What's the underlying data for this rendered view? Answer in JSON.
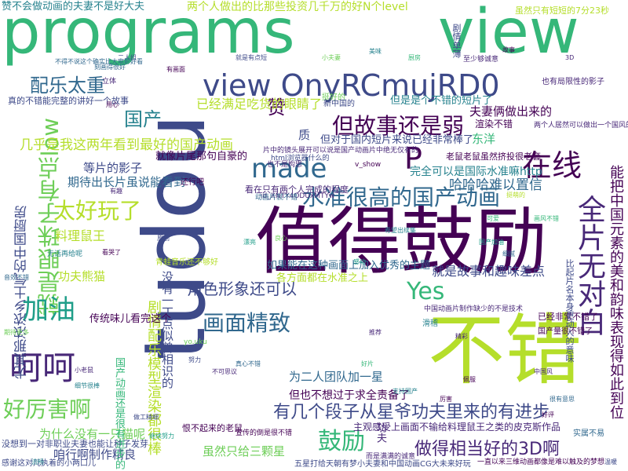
{
  "cloud": {
    "palette": [
      "#440154",
      "#482878",
      "#3e4a89",
      "#31688e",
      "#26828e",
      "#1f9e89",
      "#35b779",
      "#6ece58",
      "#b5de2b",
      "#fde725"
    ],
    "words": [
      {
        "text": "programs",
        "color": "#35b779"
      },
      {
        "text": "view",
        "color": "#35b779"
      },
      {
        "text": "tudou",
        "color": "#3e4a89"
      },
      {
        "text": "值得鼓励",
        "color": "#440154"
      },
      {
        "text": "不错",
        "color": "#b5de2b"
      },
      {
        "text": "view OnyRCmujRD0",
        "color": "#3e4a89"
      },
      {
        "text": "made",
        "color": "#31688e"
      },
      {
        "text": "P",
        "color": "#440154"
      },
      {
        "text": "在线",
        "color": "#440154"
      },
      {
        "text": "全片无对白",
        "color": "#482878"
      },
      {
        "text": "就是眼珠子有点low",
        "color": "#6ece58"
      },
      {
        "text": "水准很高的国产动画",
        "color": "#31688e"
      },
      {
        "text": "但故事还是弱",
        "color": "#440154"
      },
      {
        "text": "太好玩了",
        "color": "#b5de2b"
      },
      {
        "text": "画面精致",
        "color": "#31688e"
      },
      {
        "text": "呵呵",
        "color": "#482878"
      },
      {
        "text": "加油",
        "color": "#1f9e89"
      },
      {
        "text": "Yes",
        "color": "#35b779"
      },
      {
        "text": "鼓励",
        "color": "#35b779"
      },
      {
        "text": "好厉害啊",
        "color": "#6ece58"
      },
      {
        "text": "有几个段子从星爷功夫里来的有进步",
        "color": "#3e4a89"
      },
      {
        "text": "做得相当好的3D啊",
        "color": "#482878"
      },
      {
        "text": "角色形象还可以",
        "color": "#3e4a89"
      },
      {
        "text": "配乐太重",
        "color": "#31688e"
      },
      {
        "text": "国产",
        "color": "#26828e"
      },
      {
        "text": "赞",
        "color": "#440154"
      },
      {
        "text": "几乎是我这两年看到最好的国产动画",
        "color": "#b5de2b"
      },
      {
        "text": "能把中国元素的美和韵味表现得如此到位",
        "color": "#440154"
      },
      {
        "text": "哈哈哈难以置信",
        "color": "#31688e"
      },
      {
        "text": "已经满足吃货的眼睛了",
        "color": "#b5de2b"
      },
      {
        "text": "两个人做出的比那些投资几千万的好N个level",
        "color": "#b5de2b"
      },
      {
        "text": "赞不会做动画的夫妻不是好大夫",
        "color": "#26828e"
      },
      {
        "text": "夫妻俩做出来的",
        "color": "#440154"
      },
      {
        "text": "就是故事和趣味差点",
        "color": "#3e4a89"
      },
      {
        "text": "期待出长片虽说能看到",
        "color": "#31688e"
      },
      {
        "text": "等片的影子",
        "color": "#3e4a89"
      },
      {
        "text": "料理鼠王",
        "color": "#b5de2b"
      },
      {
        "text": "功夫熊猫",
        "color": "#b5de2b"
      },
      {
        "text": "咱行啊制作精良",
        "color": "#3e4a89"
      },
      {
        "text": "虽然只给三颗星",
        "color": "#6ece58"
      },
      {
        "text": "为什么没有一只猫呢",
        "color": "#6ece58"
      },
      {
        "text": "但也不想过于求全责备了",
        "color": "#440154"
      },
      {
        "text": "为二人团队加一星",
        "color": "#31688e"
      },
      {
        "text": "剧情配乐模型渲染都很棒",
        "color": "#b5de2b"
      },
      {
        "text": "没有一丁点似曾相识的",
        "color": "#3e4a89"
      },
      {
        "text": "尤其那浓浓乡土气的中国厨房",
        "color": "#3e4a89"
      },
      {
        "text": "东洋",
        "color": "#35b779"
      },
      {
        "text": "完全可以是国际水准嘛http",
        "color": "#26828e"
      },
      {
        "text": "传统味儿看完这个",
        "color": "#440154"
      },
      {
        "text": "但是是个不错的短片了",
        "color": "#26828e"
      },
      {
        "text": "但对于国内短片来说已经非常棒了",
        "color": "#3e4a89"
      },
      {
        "text": "如果能在这种画面上加入优秀的主题",
        "color": "#31688e"
      },
      {
        "text": "各方面都在水准之上",
        "color": "#b5de2b"
      },
      {
        "text": "虽然只有短短的7分23秒",
        "color": "#b5de2b"
      },
      {
        "text": "就像片尾那句自豪的",
        "color": "#440154"
      },
      {
        "text": "看在只有两个人完成的程度",
        "color": "#482878"
      },
      {
        "text": "老鼠老鼠虽然挤投很老套",
        "color": "#440154"
      },
      {
        "text": "五星打给天朝有梦小夫妻和中国动画CG大未来好玩",
        "color": "#3e4a89"
      },
      {
        "text": "主观感受上画面不输给料理鼠王之类的皮克斯作品",
        "color": "#482878"
      },
      {
        "text": "恨不起来的老鼠",
        "color": "#440154"
      },
      {
        "text": "已经非常不错了",
        "color": "#440154"
      },
      {
        "text": "渲染不错",
        "color": "#440154"
      },
      {
        "text": "质",
        "color": "#3e4a89"
      },
      {
        "text": "功夫",
        "color": "#482878"
      },
      {
        "text": "一直以来三维动画都像是难以触及的梦想",
        "color": "#440154"
      },
      {
        "text": "感谢这对儿执着的小两口儿",
        "color": "#3e4a89"
      },
      {
        "text": "没想到一对非职业夫妻也能让种子发芽",
        "color": "#3e4a89"
      },
      {
        "text": "真的不错能完整的讲好一个故事",
        "color": "#3e4a89"
      },
      {
        "text": "剧情单薄",
        "color": "#3e4a89"
      },
      {
        "text": "至少够诚意",
        "color": "#482878"
      },
      {
        "text": "挺好的",
        "color": "#6ece58"
      },
      {
        "text": "也有局限性的影子",
        "color": "#482878"
      },
      {
        "text": "国产动画还是很有进步的",
        "color": "#35b779"
      },
      {
        "text": "青蛙音乐还不够好",
        "color": "#b5de2b"
      },
      {
        "text": "无话再给呢",
        "color": "#26828e"
      },
      {
        "text": "实属不易",
        "color": "#31688e"
      },
      {
        "text": "新中国的",
        "color": "#3e4a89"
      },
      {
        "text": "还行吧",
        "color": "#440154"
      },
      {
        "text": "滑稽",
        "color": "#26828e"
      },
      {
        "text": "立体",
        "color": "#482878"
      },
      {
        "text": "国产量很不错了",
        "color": "#440154"
      },
      {
        "text": "比起片名本身更动人的意味",
        "color": "#3e4a89"
      },
      {
        "text": "中国动画片制作缺少的不是技术",
        "color": "#482878"
      },
      {
        "text": "两个人居然可以做出一个国风的效果",
        "color": "#482878"
      },
      {
        "text": "html浏览器什么的",
        "color": "#3e4a89"
      },
      {
        "text": "片中的镜头展开可以说是国产动画片中绝无仅有的",
        "color": "#482878"
      },
      {
        "text": "宣传的倒是很不错",
        "color": "#440154"
      },
      {
        "text": "id_XNTY4ODUxMTYw",
        "color": "#482878"
      },
      {
        "text": "v_show",
        "color": "#440154"
      },
      {
        "text": "也不是构思",
        "color": "#482878"
      },
      {
        "text": "yo.uku",
        "color": "#6ece58"
      },
      {
        "text": "而是满满的诚意",
        "color": "#482878"
      },
      {
        "text": "动画片就不错",
        "color": "#31688e"
      },
      {
        "text": "刻画得很好",
        "color": "#31688e"
      },
      {
        "text": "有画面",
        "color": "#440154"
      },
      {
        "text": "美味",
        "color": "#26828e"
      },
      {
        "text": "厨房",
        "color": "#35b779"
      },
      {
        "text": "故事",
        "color": "#440154"
      },
      {
        "text": "3D",
        "color": "#482878"
      },
      {
        "text": "二人组",
        "color": "#3e4a89"
      },
      {
        "text": "小夫妻",
        "color": "#6ece58"
      },
      {
        "text": "不得不说这个确实比大电影好看",
        "color": "#31688e"
      },
      {
        "text": "就是有点短",
        "color": "#3e4a89"
      },
      {
        "text": "希望出续集",
        "color": "#26828e"
      },
      {
        "text": "国产加油",
        "color": "#1f9e89"
      },
      {
        "text": "挺萌的",
        "color": "#b5de2b"
      },
      {
        "text": "画风不错",
        "color": "#35b779"
      },
      {
        "text": "中国风",
        "color": "#482878"
      },
      {
        "text": "很有意思",
        "color": "#31688e"
      },
      {
        "text": "好评",
        "color": "#440154"
      },
      {
        "text": "做工精细",
        "color": "#3e4a89"
      },
      {
        "text": "继续努力",
        "color": "#1f9e89"
      },
      {
        "text": "小老鼠",
        "color": "#482878"
      },
      {
        "text": "细节很棒",
        "color": "#26828e"
      },
      {
        "text": "期待更多",
        "color": "#6ece58"
      },
      {
        "text": "音效不错",
        "color": "#31688e"
      },
      {
        "text": "看哭了",
        "color": "#440154"
      },
      {
        "text": "原创",
        "color": "#3e4a89"
      },
      {
        "text": "感动",
        "color": "#1f9e89"
      },
      {
        "text": "推荐",
        "color": "#482878"
      },
      {
        "text": "好片",
        "color": "#35b779"
      },
      {
        "text": "支持国产",
        "color": "#26828e"
      },
      {
        "text": "厉害",
        "color": "#440154"
      },
      {
        "text": "不可思议",
        "color": "#482878"
      },
      {
        "text": "真心不错",
        "color": "#31688e"
      },
      {
        "text": "努力",
        "color": "#3e4a89"
      },
      {
        "text": "漂亮",
        "color": "#1f9e89"
      },
      {
        "text": "良心",
        "color": "#6ece58"
      },
      {
        "text": "精彩",
        "color": "#482878"
      },
      {
        "text": "佩服",
        "color": "#440154"
      },
      {
        "text": "可爱",
        "color": "#35b779"
      },
      {
        "text": "细腻",
        "color": "#31688e"
      },
      {
        "text": "温暖",
        "color": "#3e4a89"
      },
      {
        "text": "流畅",
        "color": "#26828e"
      },
      {
        "text": "用心",
        "color": "#440154"
      },
      {
        "text": "有趣",
        "color": "#482878"
      }
    ]
  }
}
